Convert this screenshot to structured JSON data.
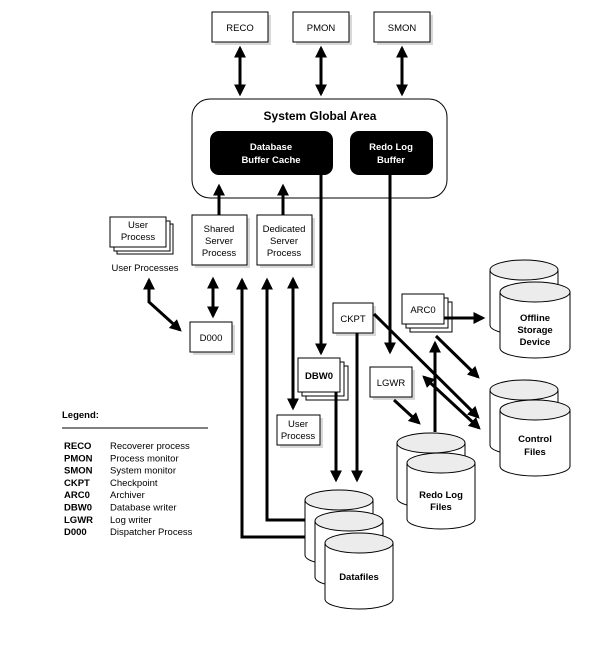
{
  "background_processes": {
    "reco": "RECO",
    "pmon": "PMON",
    "smon": "SMON"
  },
  "sga": {
    "title": "System Global Area",
    "buffer_cache": [
      "Database",
      "Buffer Cache"
    ],
    "redo_log_buffer": [
      "Redo Log",
      "Buffer"
    ]
  },
  "processes": {
    "user_process_stack": [
      "User",
      "Process"
    ],
    "user_processes_label": "User Processes",
    "shared_server": [
      "Shared",
      "Server",
      "Process"
    ],
    "dedicated_server": [
      "Dedicated",
      "Server",
      "Process"
    ],
    "d000": "D000",
    "ckpt": "CKPT",
    "arc0": "ARC0",
    "dbw0": "DBW0",
    "lgwr": "LGWR",
    "user_process": [
      "User",
      "Process"
    ]
  },
  "storage": {
    "offline": [
      "Offline",
      "Storage",
      "Device"
    ],
    "control": [
      "Control",
      "Files"
    ],
    "redo": [
      "Redo Log",
      "Files"
    ],
    "datafiles": "Datafiles"
  },
  "legend": {
    "title": "Legend:",
    "items": [
      {
        "code": "RECO",
        "desc": "Recoverer process"
      },
      {
        "code": "PMON",
        "desc": "Process monitor"
      },
      {
        "code": "SMON",
        "desc": "System monitor"
      },
      {
        "code": "CKPT",
        "desc": "Checkpoint"
      },
      {
        "code": "ARC0",
        "desc": "Archiver"
      },
      {
        "code": "DBW0",
        "desc": "Database writer"
      },
      {
        "code": "LGWR",
        "desc": "Log writer"
      },
      {
        "code": "D000",
        "desc": "Dispatcher Process"
      }
    ]
  }
}
